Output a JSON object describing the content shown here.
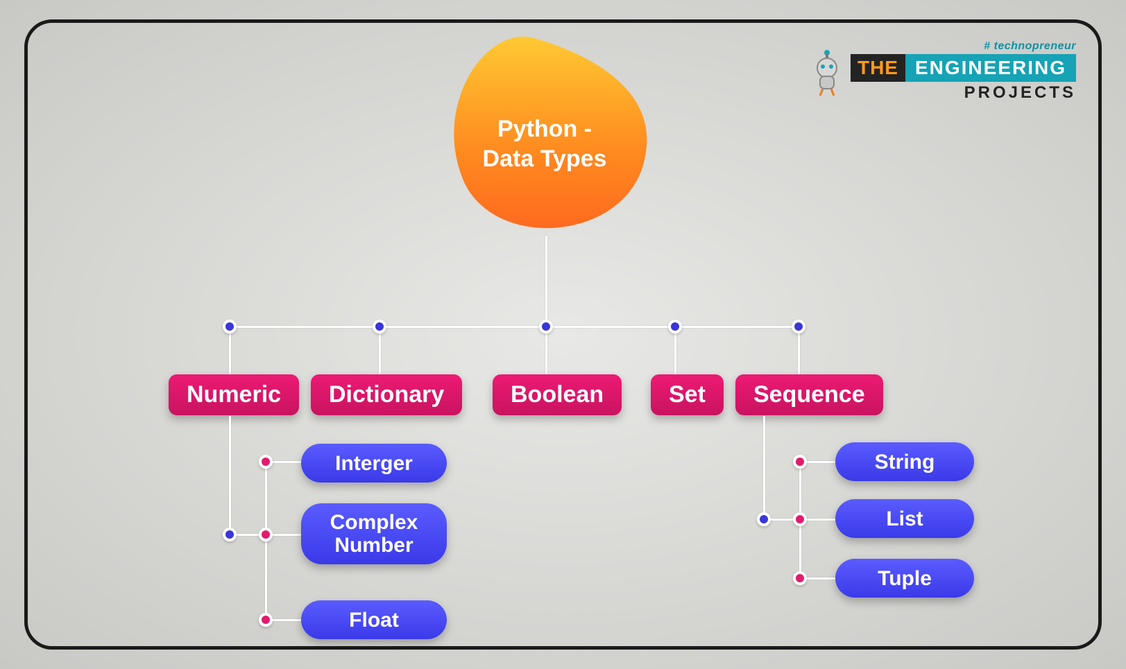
{
  "logo": {
    "tagline": "# technopreneur",
    "word_the": "THE",
    "word_engineering": "ENGINEERING",
    "word_projects": "PROJECTS"
  },
  "root": {
    "line1": "Python -",
    "line2": "Data Types"
  },
  "categories": {
    "numeric": "Numeric",
    "dictionary": "Dictionary",
    "boolean": "Boolean",
    "set": "Set",
    "sequence": "Sequence"
  },
  "numeric_children": {
    "integer": "Interger",
    "complex": "Complex Number",
    "float": "Float"
  },
  "sequence_children": {
    "string": "String",
    "list": "List",
    "tuple": "Tuple"
  }
}
